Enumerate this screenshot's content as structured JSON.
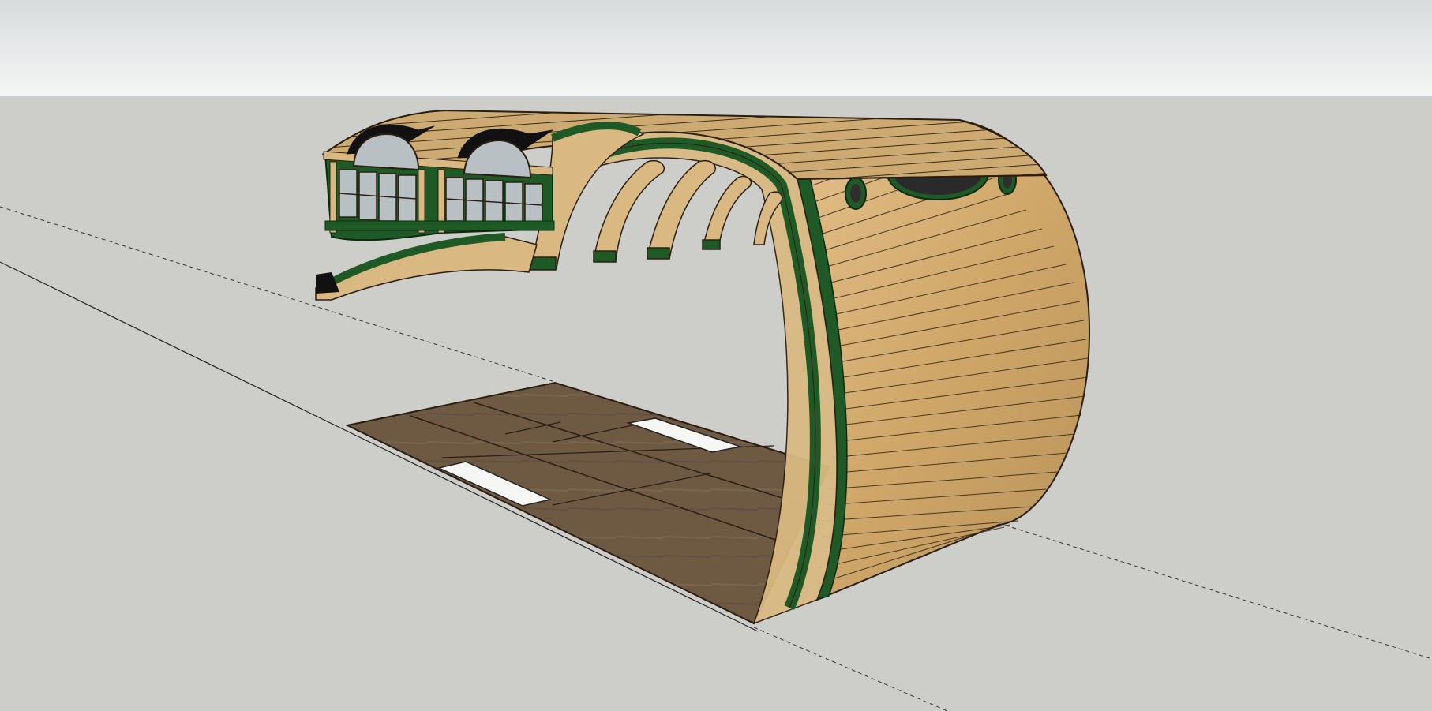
{
  "viewport": {
    "sky_color": "#f4f5f5",
    "ground_color": "#cdcdc9",
    "model_colors": {
      "wood_planks": "#d6b27a",
      "wood_dark": "#a8864f",
      "frame_green": "#1f5a26",
      "floor_brown": "#6e5a43",
      "floor_light": "#86705a",
      "window_glass": "#b9c0c4",
      "plaque": "#2a2a2a"
    }
  },
  "plaque": {
    "text": "",
    "icon": "nameplate-icon"
  }
}
